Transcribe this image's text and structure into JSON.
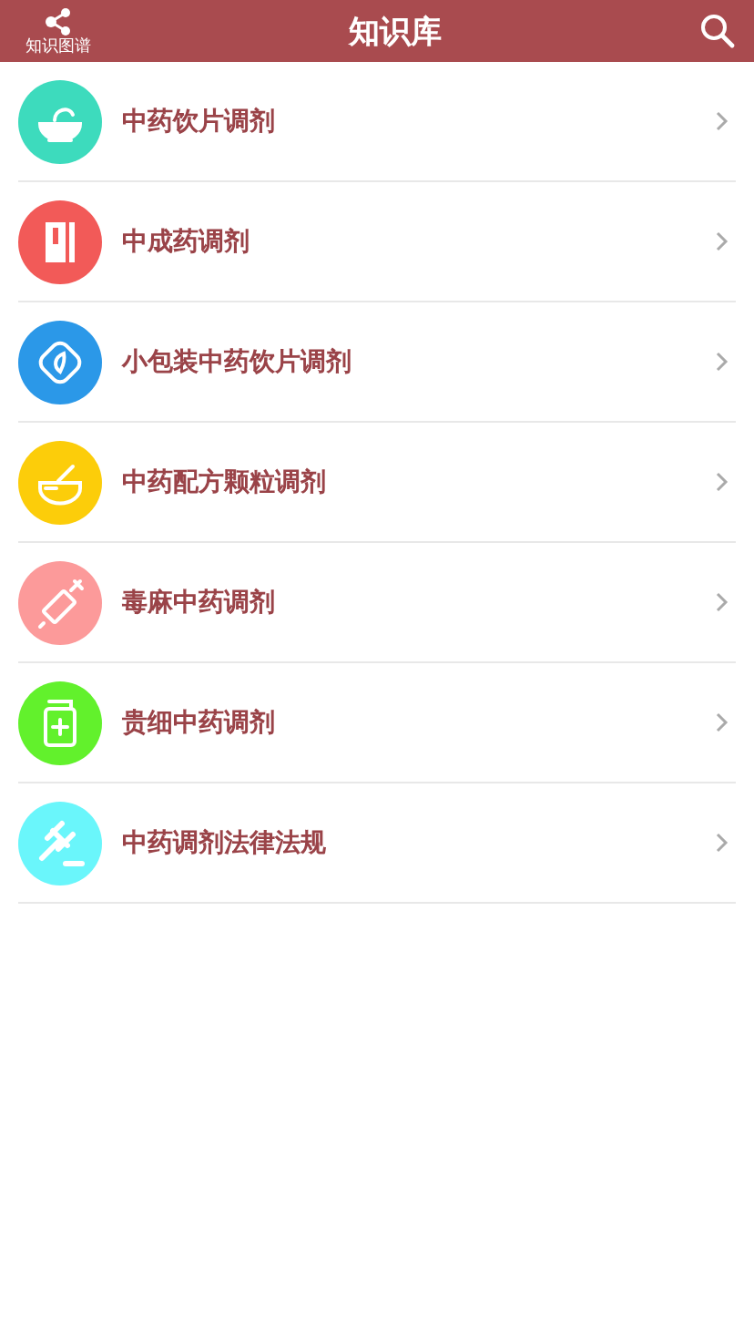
{
  "header": {
    "logo_label": "知识图谱",
    "title": "知识库"
  },
  "items": [
    {
      "label": "中药饮片调剂",
      "kind": "mortar",
      "color": "#3ddbbd"
    },
    {
      "label": "中成药调剂",
      "kind": "book",
      "color": "#f25a58"
    },
    {
      "label": "小包装中药饮片调剂",
      "kind": "leaf",
      "color": "#2b98e8"
    },
    {
      "label": "中药配方颗粒调剂",
      "kind": "bowl",
      "color": "#fccd0a"
    },
    {
      "label": "毒麻中药调剂",
      "kind": "syringe",
      "color": "#fc9a9a"
    },
    {
      "label": "贵细中药调剂",
      "kind": "jar",
      "color": "#62f12c"
    },
    {
      "label": "中药调剂法律法规",
      "kind": "gavel",
      "color": "#6af6fb"
    }
  ]
}
